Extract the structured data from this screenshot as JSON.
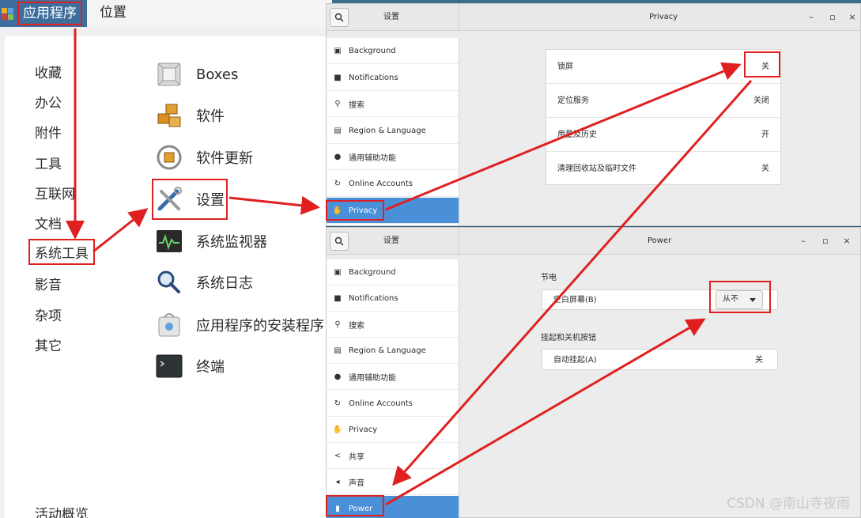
{
  "topbar": {
    "applications": "应用程序",
    "places": "位置"
  },
  "apps_menu": {
    "categories": [
      "收藏",
      "办公",
      "附件",
      "工具",
      "互联网",
      "文档",
      "系统工具",
      "影音",
      "杂项",
      "其它"
    ],
    "overview": "活动概览",
    "apps": [
      "Boxes",
      "软件",
      "软件更新",
      "设置",
      "系统监视器",
      "系统日志",
      "应用程序的安装程序",
      "终端"
    ]
  },
  "privacy_window": {
    "left_title": "设置",
    "title": "Privacy",
    "controls": {
      "minimize": "–",
      "maximize": "▫",
      "close": "×"
    },
    "sidebar": [
      "Background",
      "Notifications",
      "搜索",
      "Region & Language",
      "通用辅助功能",
      "Online Accounts",
      "Privacy"
    ],
    "rows": [
      {
        "key": "锁屏",
        "value": "关"
      },
      {
        "key": "定位服务",
        "value": "关闭"
      },
      {
        "key": "用量及历史",
        "value": "开"
      },
      {
        "key": "清理回收站及临时文件",
        "value": "关"
      }
    ]
  },
  "power_window": {
    "left_title": "设置",
    "title": "Power",
    "controls": {
      "minimize": "–",
      "maximize": "▫",
      "close": "×"
    },
    "sidebar": [
      "Background",
      "Notifications",
      "搜索",
      "Region & Language",
      "通用辅助功能",
      "Online Accounts",
      "Privacy",
      "共享",
      "声音",
      "Power"
    ],
    "section_power_saving": "节电",
    "blank_screen_label": "空白屏幕(B)",
    "blank_screen_value": "从不",
    "section_suspend": "挂起和关机按钮",
    "auto_suspend_label": "自动挂起(A)",
    "auto_suspend_value": "关"
  },
  "watermark": "CSDN @南山寺夜雨",
  "colors": {
    "accent": "#4a90d9",
    "annotation": "#e02020"
  }
}
